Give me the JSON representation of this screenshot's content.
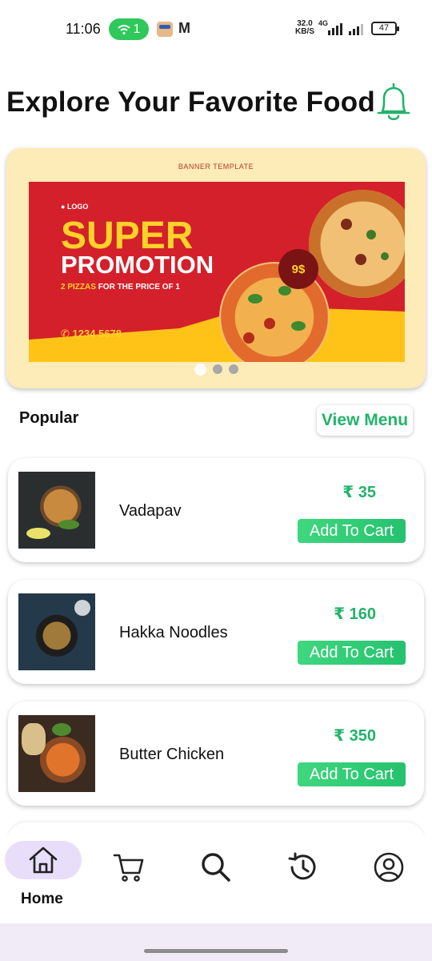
{
  "status_bar": {
    "time": "11:06",
    "hotspot_count": "1",
    "network_speed_value": "32.0",
    "network_speed_unit": "KB/S",
    "network_type": "4G",
    "battery": "47"
  },
  "header": {
    "title": "Explore Your Favorite Food",
    "bell_icon": "bell-icon",
    "accent_color": "#22b36b"
  },
  "banner": {
    "template_label": "BANNER TEMPLATE",
    "logo_text": "LOGO",
    "headline": "SUPER",
    "subheadline": "PROMOTION",
    "offer_highlight": "2 PIZZAS",
    "offer_text": "FOR THE PRICE OF 1",
    "price_badge": "9$",
    "phone": "1234 5678",
    "carousel_pages": 3,
    "carousel_active_index": 0
  },
  "popular": {
    "label": "Popular",
    "view_menu_label": "View Menu",
    "items": [
      {
        "name": "Vadapav",
        "price": "₹ 35",
        "button_label": "Add To Cart"
      },
      {
        "name": "Hakka Noodles",
        "price": "₹ 160",
        "button_label": "Add To Cart"
      },
      {
        "name": "Butter Chicken",
        "price": "₹ 350",
        "button_label": "Add To Cart"
      }
    ]
  },
  "bottom_nav": {
    "items": [
      {
        "icon": "home-icon",
        "label": "Home",
        "active": true
      },
      {
        "icon": "cart-icon",
        "label": "",
        "active": false
      },
      {
        "icon": "search-icon",
        "label": "",
        "active": false
      },
      {
        "icon": "history-icon",
        "label": "",
        "active": false
      },
      {
        "icon": "profile-icon",
        "label": "",
        "active": false
      }
    ],
    "active_pill_color": "#e9defa"
  }
}
